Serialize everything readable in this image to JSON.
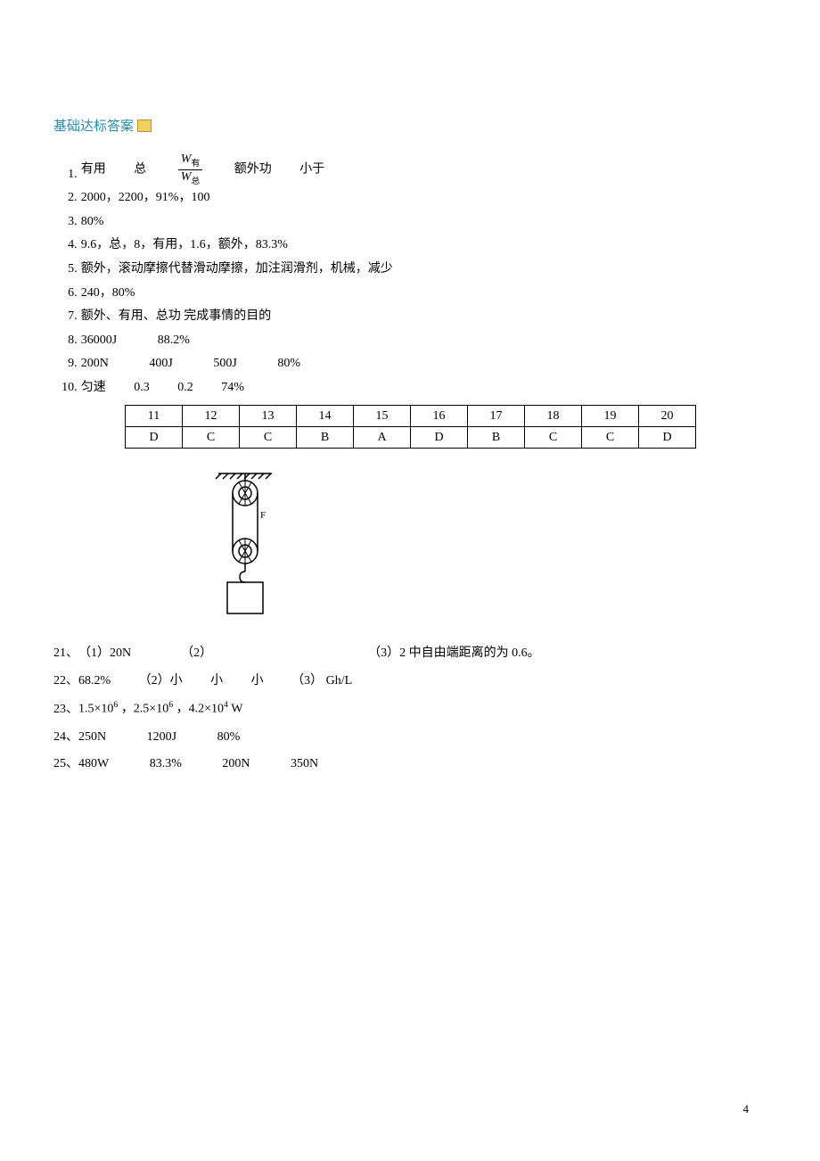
{
  "title": "基础达标答案",
  "answers": {
    "a1": {
      "n": "1.",
      "p1": "有用",
      "p2": "总",
      "p3": "额外功",
      "p4": "小于"
    },
    "a2": {
      "n": "2.",
      "t": "2000，2200，91%，100"
    },
    "a3": {
      "n": "3.",
      "t": "80%"
    },
    "a4": {
      "n": "4.",
      "t": "9.6，总，8，有用，1.6，额外，83.3%"
    },
    "a5": {
      "n": "5.",
      "t": "额外，滚动摩擦代替滑动摩擦，加注润滑剂，机械，减少"
    },
    "a6": {
      "n": "6.",
      "t": "240，80%"
    },
    "a7": {
      "n": "7.",
      "t": "额外、有用、总功 完成事情的目的"
    },
    "a8": {
      "n": "8.",
      "p1": "36000J",
      "p2": "88.2%"
    },
    "a9": {
      "n": "9.",
      "p1": "200N",
      "p2": "400J",
      "p3": "500J",
      "p4": "80%"
    },
    "a10": {
      "n": "10.",
      "p1": "匀速",
      "p2": "0.3",
      "p3": "0.2",
      "p4": "74%"
    }
  },
  "table": {
    "headers": [
      "11",
      "12",
      "13",
      "14",
      "15",
      "16",
      "17",
      "18",
      "19",
      "20"
    ],
    "values": [
      "D",
      "C",
      "C",
      "B",
      "A",
      "D",
      "B",
      "C",
      "C",
      "D"
    ]
  },
  "after": {
    "a21": {
      "n": "21、",
      "p1": "（1）20N",
      "p2": "（2）",
      "p3": "（3）2 中自由端距离的为 0.6。"
    },
    "a22": {
      "n": "22、",
      "p1": "68.2%",
      "p2": "（2）小",
      "p3": "小",
      "p4": "小",
      "p5": "（3） Gh/L"
    },
    "a23": {
      "n": "23、",
      "e1": "1.5×10",
      "s1": "6",
      "e2": "，2.5×10",
      "s2": "6",
      "e3": "，4.2×10",
      "s3": "4",
      "unit": "W"
    },
    "a24": {
      "n": "24、",
      "p1": "250N",
      "p2": "1200J",
      "p3": "80%"
    },
    "a25": {
      "n": "25、",
      "p1": "480W",
      "p2": "83.3%",
      "p3": "200N",
      "p4": "350N"
    }
  },
  "frac": {
    "top_w": "W",
    "top_sub": "有",
    "bot_w": "W",
    "bot_sub": "总"
  },
  "page_num": "4",
  "pulley_label": "F"
}
